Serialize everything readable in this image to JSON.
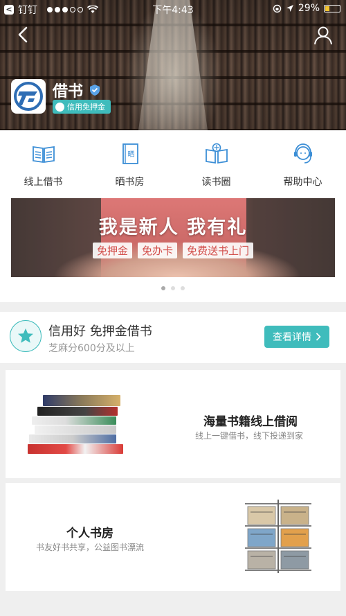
{
  "status_bar": {
    "carrier": "钉钉",
    "time": "下午4:43",
    "battery": "29%",
    "battery_level": 0.29,
    "signal_bars_filled": 3,
    "signal_bars_total": 5
  },
  "header": {
    "title": "借书",
    "credit_tag": "信用免押金"
  },
  "menu": [
    {
      "label": "线上借书",
      "icon": "book-open-icon"
    },
    {
      "label": "晒书房",
      "icon": "book-cover-icon"
    },
    {
      "label": "读书圈",
      "icon": "reading-circle-icon"
    },
    {
      "label": "帮助中心",
      "icon": "headset-icon"
    }
  ],
  "banner": {
    "headline": "我是新人  我有礼",
    "tags": [
      "免押金",
      "免办卡",
      "免费送书上门"
    ],
    "page_index": 1,
    "page_count": 3
  },
  "credit": {
    "title": "信用好 免押金借书",
    "subtitle": "芝麻分600分及以上",
    "button": "查看详情"
  },
  "features": [
    {
      "title": "海量书籍线上借阅",
      "subtitle": "线上一键借书，线下投递到家"
    },
    {
      "title": "个人书房",
      "subtitle": "书友好书共享，公益图书漂流"
    }
  ],
  "colors": {
    "accent": "#3fbcbc",
    "icon_blue": "#3b8ed6",
    "banner_red": "#d24d4a"
  }
}
